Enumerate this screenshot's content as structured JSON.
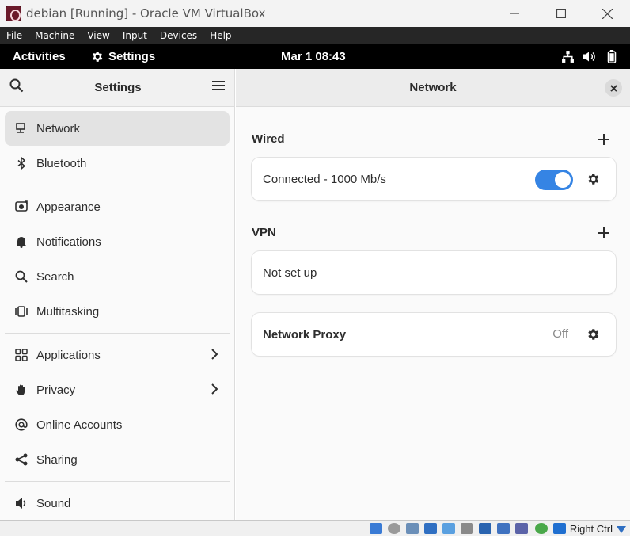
{
  "window": {
    "title": "debian [Running] - Oracle VM VirtualBox",
    "controls": [
      "minimize",
      "maximize",
      "close"
    ]
  },
  "menubar": {
    "items": [
      "File",
      "Machine",
      "View",
      "Input",
      "Devices",
      "Help"
    ]
  },
  "topbar": {
    "activities": "Activities",
    "app_menu": "Settings",
    "clock": "Mar 1  08:43",
    "tray_icons": [
      "network-wired-icon",
      "volume-icon",
      "battery-icon"
    ]
  },
  "sidebar": {
    "title": "Settings",
    "items": [
      {
        "label": "Network",
        "icon": "network-icon",
        "active": true
      },
      {
        "label": "Bluetooth",
        "icon": "bluetooth-icon"
      },
      {
        "label": "Appearance",
        "icon": "appearance-icon"
      },
      {
        "label": "Notifications",
        "icon": "bell-icon"
      },
      {
        "label": "Search",
        "icon": "search-icon"
      },
      {
        "label": "Multitasking",
        "icon": "multitasking-icon"
      },
      {
        "label": "Applications",
        "icon": "apps-grid-icon",
        "submenu": true
      },
      {
        "label": "Privacy",
        "icon": "hand-icon",
        "submenu": true
      },
      {
        "label": "Online Accounts",
        "icon": "at-icon"
      },
      {
        "label": "Sharing",
        "icon": "share-icon"
      },
      {
        "label": "Sound",
        "icon": "speaker-icon"
      }
    ]
  },
  "content": {
    "title": "Network",
    "wired": {
      "title": "Wired",
      "status": "Connected - 1000 Mb/s",
      "enabled": true
    },
    "vpn": {
      "title": "VPN",
      "status": "Not set up"
    },
    "proxy": {
      "label": "Network Proxy",
      "state": "Off"
    }
  },
  "statusbar": {
    "host_key": "Right Ctrl"
  },
  "colors": {
    "accent": "#3584e4",
    "topbar": "#000000",
    "menubar": "#262626"
  }
}
